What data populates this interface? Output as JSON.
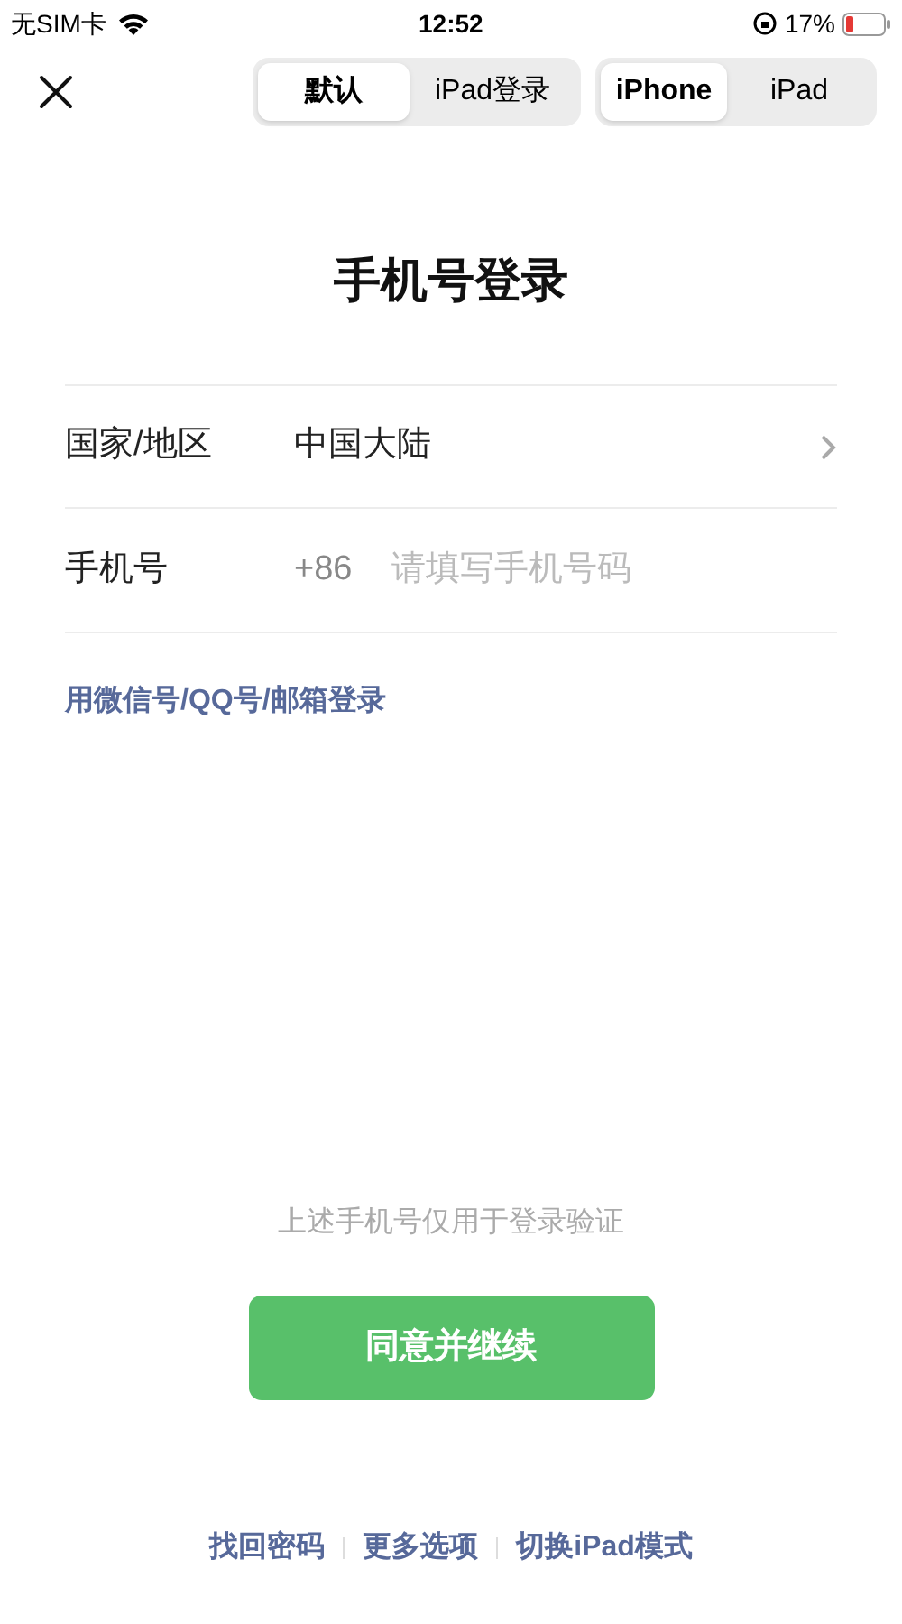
{
  "status_bar": {
    "carrier": "无SIM卡",
    "time": "12:52",
    "battery": "17%"
  },
  "mode_switch": [
    {
      "label": "默认",
      "selected": true
    },
    {
      "label": "iPad登录",
      "selected": false
    }
  ],
  "device_switch": [
    {
      "label": "iPhone",
      "selected": true
    },
    {
      "label": "iPad",
      "selected": false
    }
  ],
  "title": "手机号登录",
  "form": {
    "region_label": "国家/地区",
    "region_value": "中国大陆",
    "phone_label": "手机号",
    "country_code": "+86",
    "phone_placeholder": "请填写手机号码"
  },
  "alt_login_link": "用微信号/QQ号/邮箱登录",
  "notice": "上述手机号仅用于登录验证",
  "continue_button": "同意并继续",
  "footer_links": [
    "找回密码",
    "更多选项",
    "切换iPad模式"
  ]
}
